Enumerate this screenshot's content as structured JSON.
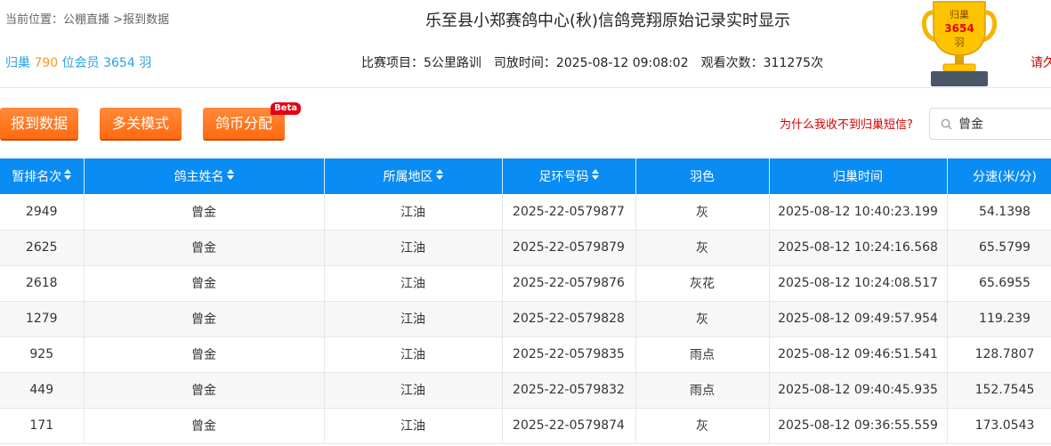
{
  "breadcrumb": {
    "prefix": "当前位置：",
    "crumb1": "公棚直播",
    "sep": " >",
    "crumb2": "报到数据"
  },
  "title": "乐至县小郑赛鸽中心(秋)信鸽竞翔原始记录实时显示",
  "stats": {
    "label1": "归巢",
    "count1": "790",
    "label2": "位会员",
    "count2": "3654",
    "label3": "羽"
  },
  "race": {
    "project_label": "比赛项目：",
    "project_value": "5公里路训",
    "release_label": "司放时间：",
    "release_value": "2025-08-12 09:08:02",
    "views_label": "观看次数：",
    "views_value": "311275次"
  },
  "trophy": {
    "line1": "归巢",
    "count": "3654",
    "line2": "羽"
  },
  "side_link": "请久",
  "buttons": {
    "report": "报到数据",
    "multi": "多关模式",
    "coin": "鸽币分配",
    "beta": "Beta"
  },
  "why_link": "为什么我收不到归巢短信?",
  "search": {
    "value": "曾金",
    "placeholder": ""
  },
  "colors": {
    "header_bg": "#0a8cf5",
    "button_orange": "#ff7a22",
    "link_red": "#d40000",
    "count_orange": "#f39a1e",
    "count_blue": "#2aa0e6"
  },
  "table": {
    "headers": [
      "暂排名次",
      "鸽主姓名",
      "所属地区",
      "足环号码",
      "羽色",
      "归巢时间",
      "分速(米/分)"
    ],
    "sortable": [
      true,
      true,
      true,
      true,
      false,
      false,
      false
    ],
    "rows": [
      [
        "2949",
        "曾金",
        "江油",
        "2025-22-0579877",
        "灰",
        "2025-08-12 10:40:23.199",
        "54.1398"
      ],
      [
        "2625",
        "曾金",
        "江油",
        "2025-22-0579879",
        "灰",
        "2025-08-12 10:24:16.568",
        "65.5799"
      ],
      [
        "2618",
        "曾金",
        "江油",
        "2025-22-0579876",
        "灰花",
        "2025-08-12 10:24:08.517",
        "65.6955"
      ],
      [
        "1279",
        "曾金",
        "江油",
        "2025-22-0579828",
        "灰",
        "2025-08-12 09:49:57.954",
        "119.239"
      ],
      [
        "925",
        "曾金",
        "江油",
        "2025-22-0579835",
        "雨点",
        "2025-08-12 09:46:51.541",
        "128.7807"
      ],
      [
        "449",
        "曾金",
        "江油",
        "2025-22-0579832",
        "雨点",
        "2025-08-12 09:40:45.935",
        "152.7545"
      ],
      [
        "171",
        "曾金",
        "江油",
        "2025-22-0579874",
        "灰",
        "2025-08-12 09:36:55.559",
        "173.0543"
      ]
    ]
  }
}
